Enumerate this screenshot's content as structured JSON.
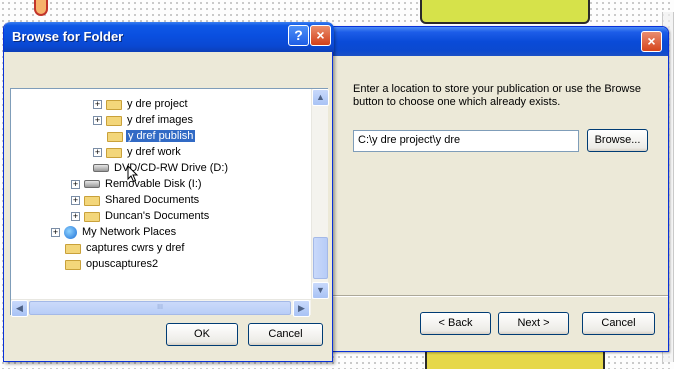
{
  "browse_dialog": {
    "title": "Browse for Folder",
    "help_button": "?",
    "close_button": "×",
    "tree": [
      {
        "label": "y dre project",
        "expander": "+",
        "icon": "folder-icon"
      },
      {
        "label": "y dref images",
        "expander": "+",
        "icon": "folder-icon"
      },
      {
        "label": "y dref publish",
        "expander": "",
        "icon": "folder-open-icon",
        "selected": true
      },
      {
        "label": "y dref work",
        "expander": "+",
        "icon": "folder-icon"
      },
      {
        "label": "DVD/CD-RW Drive (D:)",
        "expander": "",
        "icon": "cd-drive-icon"
      },
      {
        "label": "Removable Disk (I:)",
        "expander": "+",
        "icon": "removable-disk-icon"
      },
      {
        "label": "Shared Documents",
        "expander": "+",
        "icon": "folder-icon"
      },
      {
        "label": "Duncan's Documents",
        "expander": "+",
        "icon": "folder-icon"
      },
      {
        "label": "My Network Places",
        "expander": "+",
        "icon": "network-places-icon"
      },
      {
        "label": "captures cwrs y dref",
        "expander": "",
        "icon": "folder-icon"
      },
      {
        "label": "opuscaptures2",
        "expander": "",
        "icon": "folder-icon"
      }
    ],
    "scroll_up": "▲",
    "scroll_down": "▼",
    "scroll_left": "◀",
    "scroll_right": "▶",
    "hscroll_grip": "III",
    "ok_label": "OK",
    "cancel_label": "Cancel"
  },
  "wizard_dialog": {
    "close_button": "×",
    "description": "Enter a location to store your publication or use the Browse button to choose one which already exists.",
    "path_value": "C:\\y dre project\\y dre",
    "browse_label": "Browse...",
    "back_label": "< Back",
    "next_label": "Next >",
    "cancel_label": "Cancel"
  },
  "colors": {
    "xp_title_blue": "#0a4fe0",
    "selection_blue": "#316ac5",
    "dialog_face": "#ece9d8"
  }
}
